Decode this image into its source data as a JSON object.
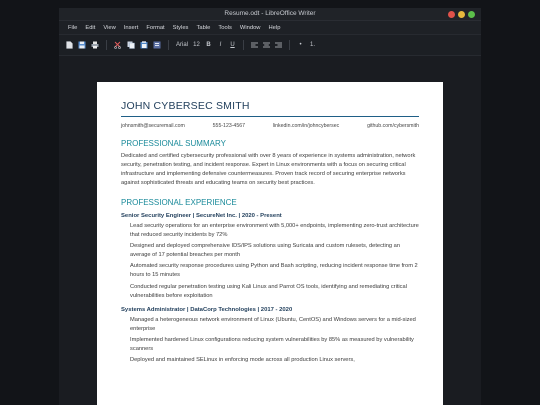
{
  "window": {
    "title": "Resume.odt - LibreOffice Writer",
    "controls": [
      {
        "name": "close",
        "color": "#e0524a"
      },
      {
        "name": "minimize",
        "color": "#e6b93d"
      },
      {
        "name": "maximize",
        "color": "#5cbf4a"
      }
    ]
  },
  "menubar": [
    "File",
    "Edit",
    "View",
    "Insert",
    "Format",
    "Styles",
    "Table",
    "Tools",
    "Window",
    "Help"
  ],
  "toolbar": {
    "new_icon": "new-document-icon",
    "save_icon": "save-icon",
    "print_icon": "print-icon",
    "cut_icon": "cut-icon",
    "copy_icon": "copy-icon",
    "paste_icon": "paste-icon",
    "font_name": "Arial",
    "font_size": "12",
    "bold": "B",
    "italic": "I",
    "underline": "U",
    "align_icons": [
      "align-left-icon",
      "align-center-icon",
      "align-right-icon"
    ],
    "bullet": "•",
    "numbered": "1."
  },
  "resume": {
    "name": "JOHN CYBERSEC SMITH",
    "contact": [
      "johnsmith@securemail.com",
      "555-123-4567",
      "linkedin.com/in/johncybersec",
      "github.com/cybersmith"
    ],
    "summary_title": "PROFESSIONAL SUMMARY",
    "summary": "Dedicated and certified cybersecurity professional with over 8 years of experience in systems administration, network security, penetration testing, and incident response. Expert in Linux environments with a focus on securing critical infrastructure and implementing defensive countermeasures. Proven track record of securing enterprise networks against sophisticated threats and educating teams on security best practices.",
    "experience_title": "PROFESSIONAL EXPERIENCE",
    "jobs": [
      {
        "role": "Senior Security Engineer | SecureNet Inc. | 2020 - Present",
        "bullets": [
          "Lead security operations for an enterprise environment with 5,000+ endpoints, implementing zero-trust architecture that reduced security incidents by 72%",
          "Designed and deployed comprehensive IDS/IPS solutions using Suricata and custom rulesets, detecting an average of 17 potential breaches per month",
          "Automated security response procedures using Python and Bash scripting, reducing incident response time from 2 hours to 15 minutes",
          "Conducted regular penetration testing using Kali Linux and Parrot OS tools, identifying and remediating critical vulnerabilities before exploitation"
        ]
      },
      {
        "role": "Systems Administrator | DataCorp Technologies | 2017 - 2020",
        "bullets": [
          "Managed a heterogeneous network environment of Linux (Ubuntu, CentOS) and Windows servers for a mid-sized enterprise",
          "Implemented hardened Linux configurations reducing system vulnerabilities by 85% as measured by vulnerability scanners",
          "Deployed and maintained SELinux in enforcing mode across all production Linux servers,"
        ]
      }
    ]
  }
}
